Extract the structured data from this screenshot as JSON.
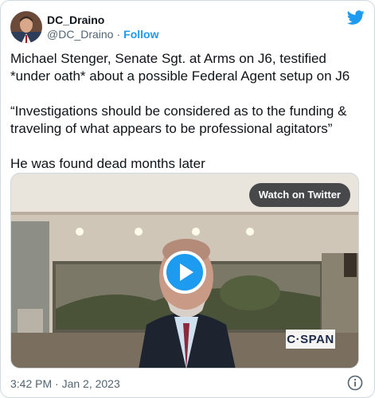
{
  "author": {
    "display_name": "DC_Draino",
    "handle": "@DC_Draino",
    "separator": "·",
    "follow_label": "Follow"
  },
  "tweet": {
    "text": "Michael Stenger, Senate Sgt. at Arms on J6, testified *under oath* about a possible Federal Agent setup on J6\n\n“Investigations should be considered as to the funding & traveling of what appears to be professional agitators”\n\nHe was found dead months later"
  },
  "media": {
    "watch_label": "Watch on Twitter",
    "network_logo_text": "C·SPAN"
  },
  "footer": {
    "timestamp": "3:42 PM · Jan 2, 2023"
  },
  "icons": {
    "brand": "twitter-bird-icon",
    "info": "info-icon",
    "play": "play-icon"
  },
  "colors": {
    "accent": "#1d9bf0",
    "text": "#0f1419",
    "secondary_text": "#536471",
    "border": "#cfd9de"
  }
}
